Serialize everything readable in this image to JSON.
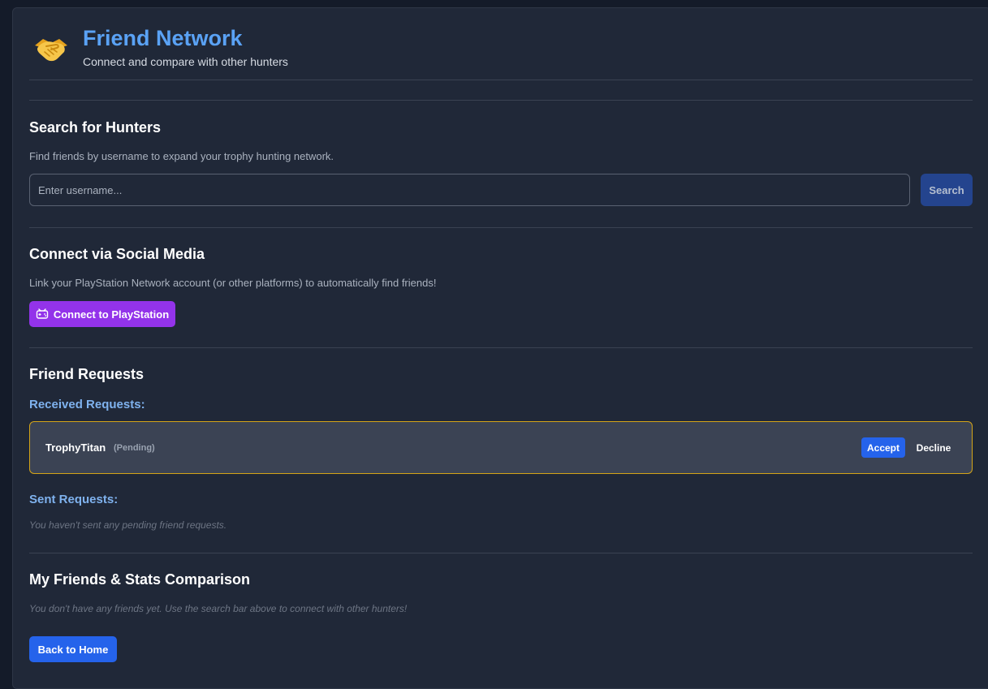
{
  "header": {
    "logo_icon": "handshake-icon",
    "title": "Friend Network",
    "subtitle": "Connect and compare with other hunters"
  },
  "search": {
    "title": "Search for Hunters",
    "description": "Find friends by username to expand your trophy hunting network.",
    "placeholder": "Enter username...",
    "button_label": "Search"
  },
  "social": {
    "title": "Connect via Social Media",
    "description": "Link your PlayStation Network account (or other platforms) to automatically find friends!",
    "button_icon": "gamepad-icon",
    "button_label": "Connect to PlayStation"
  },
  "requests": {
    "title": "Friend Requests",
    "received_heading": "Received Requests:",
    "received": [
      {
        "username": "TrophyTitan",
        "status": "(Pending)",
        "accept_label": "Accept",
        "decline_label": "Decline"
      }
    ],
    "sent_heading": "Sent Requests:",
    "sent_empty": "You haven't sent any pending friend requests."
  },
  "friends": {
    "title": "My Friends & Stats Comparison",
    "empty_message": "You don't have any friends yet. Use the search bar above to connect with other hunters!"
  },
  "footer": {
    "back_label": "Back to Home"
  },
  "colors": {
    "accent_blue": "#2563eb",
    "title_blue": "#5aa2f5",
    "playstation_purple": "#9333ea",
    "pending_border": "#d4a418",
    "panel_bg": "#202838"
  }
}
